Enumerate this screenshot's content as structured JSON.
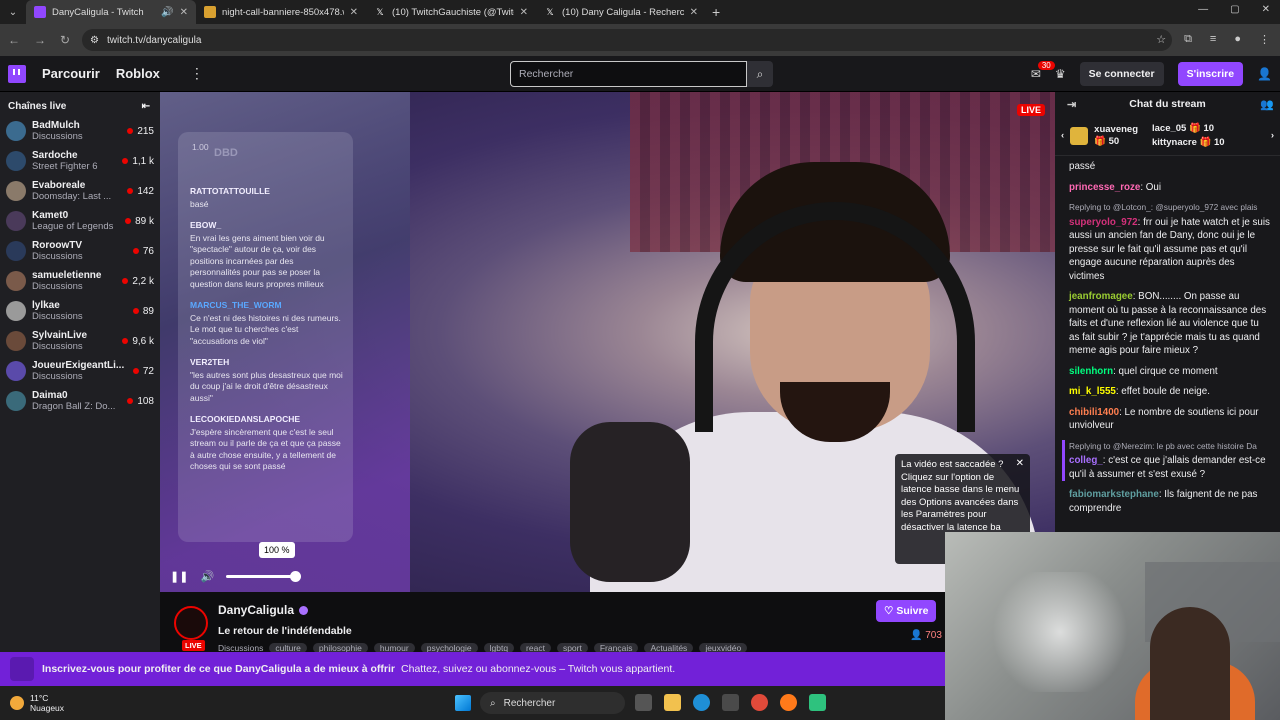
{
  "browser": {
    "tabs": [
      {
        "title": "DanyCaligula - Twitch",
        "active": true,
        "icon": "twitch-icon"
      },
      {
        "title": "night-call-banniere-850x478.w",
        "active": false,
        "icon": "image-icon"
      },
      {
        "title": "(10) TwitchGauchiste (@Twitch",
        "active": false,
        "icon": "x-icon"
      },
      {
        "title": "(10) Dany Caligula - Recherche",
        "active": false,
        "icon": "x-icon"
      }
    ],
    "url": "twitch.tv/danycaligula"
  },
  "nav": {
    "browse": "Parcourir",
    "game": "Roblox",
    "search_placeholder": "Rechercher",
    "notif_count": "30",
    "login": "Se connecter",
    "signup": "S'inscrire"
  },
  "sidebar": {
    "title": "Chaînes live",
    "channels": [
      {
        "name": "BadMulch",
        "game": "Discussions",
        "viewers": "215",
        "color": "#3b6b8f"
      },
      {
        "name": "Sardoche",
        "game": "Street Fighter 6",
        "viewers": "1,1 k",
        "color": "#2d4a6b"
      },
      {
        "name": "Evaboreale",
        "game": "Doomsday: Last ...",
        "viewers": "142",
        "color": "#8a7a6a"
      },
      {
        "name": "Kamet0",
        "game": "League of Legends",
        "viewers": "89 k",
        "color": "#4a3a5a"
      },
      {
        "name": "RoroowTV",
        "game": "Discussions",
        "viewers": "76",
        "color": "#2a3a5a"
      },
      {
        "name": "samueletienne",
        "game": "Discussions",
        "viewers": "2,2 k",
        "color": "#7a5a4a"
      },
      {
        "name": "lylkae",
        "game": "Discussions",
        "viewers": "89",
        "color": "#9a9a9a"
      },
      {
        "name": "SylvainLive",
        "game": "Discussions",
        "viewers": "9,6 k",
        "color": "#6a4a3a"
      },
      {
        "name": "JoueurExigeantLi...",
        "game": "Discussions",
        "viewers": "72",
        "color": "#5a4aaa"
      },
      {
        "name": "Daima0",
        "game": "Dragon Ball Z: Do...",
        "viewers": "108",
        "color": "#3a6a7a"
      }
    ]
  },
  "player": {
    "live": "LIVE",
    "overlay_top": "1.00",
    "overlay_top2": "DBD",
    "overlay_msgs": [
      {
        "user": "RATTOTATTOUILLE",
        "text": "basé",
        "blue": false
      },
      {
        "user": "EBOW_",
        "text": "En vrai les gens aiment bien voir du \"spectacle\" autour de ça, voir des positions incarnées par des personnalités pour pas se poser la question dans leurs propres milieux",
        "blue": false
      },
      {
        "user": "MARCUS_THE_WORM",
        "text": "Ce n'est ni des histoires ni des rumeurs. Le mot que tu cherches c'est \"accusations de viol\"",
        "blue": true
      },
      {
        "user": "VER2TEH",
        "text": "\"les autres sont plus desastreux que moi du coup j'ai le droit d'être désastreux aussi\"",
        "blue": false
      },
      {
        "user": "LECOOKIEDANSLAPOCHE",
        "text": "J'espère sincèrement que c'est le seul stream ou il parle de ça et que ça passe à autre chose ensuite, y a tellement de choses qui se sont passé",
        "blue": false
      }
    ],
    "volume_label": "100 %",
    "volume_level": 1.0,
    "latency_text": "La vidéo est saccadée ? Cliquez sur l'option de latence basse dans le menu des Options avancées dans les Paramètres pour désactiver la latence ba"
  },
  "channel": {
    "name": "DanyCaligula",
    "title": "Le retour de l'indéfendable",
    "category": "Discussions",
    "tags": [
      "culture",
      "philosophie",
      "humour",
      "psychologie",
      "lgbtq",
      "react",
      "sport",
      "Français",
      "Actualités",
      "jeuxvidéo"
    ],
    "follow": "Suivre",
    "viewers": "703",
    "live": "LIVE"
  },
  "banner": {
    "bold": "Inscrivez-vous pour profiter de ce que DanyCaligula a de mieux à offrir",
    "text": "Chattez, suivez ou abonnez-vous – Twitch vous appartient."
  },
  "chat": {
    "title": "Chat du stream",
    "gifts": [
      {
        "user": "xuaveneg",
        "count": "50"
      },
      {
        "user": "lace_05",
        "count": "10"
      },
      {
        "user": "kittynacre",
        "count": "10"
      }
    ],
    "messages": [
      {
        "reply": "",
        "user": "",
        "color": "#efeff1",
        "text": "passé",
        "hl": false
      },
      {
        "reply": "",
        "user": "princesse_roze",
        "color": "#ff69b4",
        "text": ": Oui",
        "hl": false
      },
      {
        "reply": "Replying to @Lotcon_: @superyolo_972 avec plais",
        "user": "superyolo_972",
        "color": "#d4317b",
        "text": ": frr oui je hate watch et je suis aussi un ancien fan de Dany, donc oui je le presse sur le fait qu'il assume pas et qu'il engage aucune réparation auprès des victimes",
        "hl": false
      },
      {
        "reply": "",
        "user": "jeanfromagee",
        "color": "#9acd32",
        "text": ": BON........ On passe au moment où tu passe à la reconnaissance des faits et d'une reflexion lié au violence que tu as fait subir ? je t'apprécie mais tu as quand meme agis pour faire mieux ?",
        "hl": false
      },
      {
        "reply": "",
        "user": "silenhorn",
        "color": "#00ff7f",
        "text": ": quel cirque ce moment",
        "hl": false
      },
      {
        "reply": "",
        "user": "mi_k_l555",
        "color": "#ffff00",
        "text": ": effet boule de neige.",
        "hl": false
      },
      {
        "reply": "",
        "user": "chibili1400",
        "color": "#ff7f50",
        "text": ": Le nombre de soutiens ici pour unviolveur",
        "hl": false
      },
      {
        "reply": "Replying to @Nerezim: le pb avec cette histoire Da",
        "user": "colleg_",
        "color": "#a970ff",
        "text": ": c'est ce que j'allais demander est-ce qu'il à assumer et s'est exusé ?",
        "hl": true
      },
      {
        "reply": "",
        "user": "fabiomarkstephane",
        "color": "#5f9ea0",
        "text": ": Ils faignent de ne pas comprendre",
        "hl": false
      }
    ]
  },
  "taskbar": {
    "temp": "11°C",
    "weather": "Nuageux",
    "search": "Rechercher"
  }
}
